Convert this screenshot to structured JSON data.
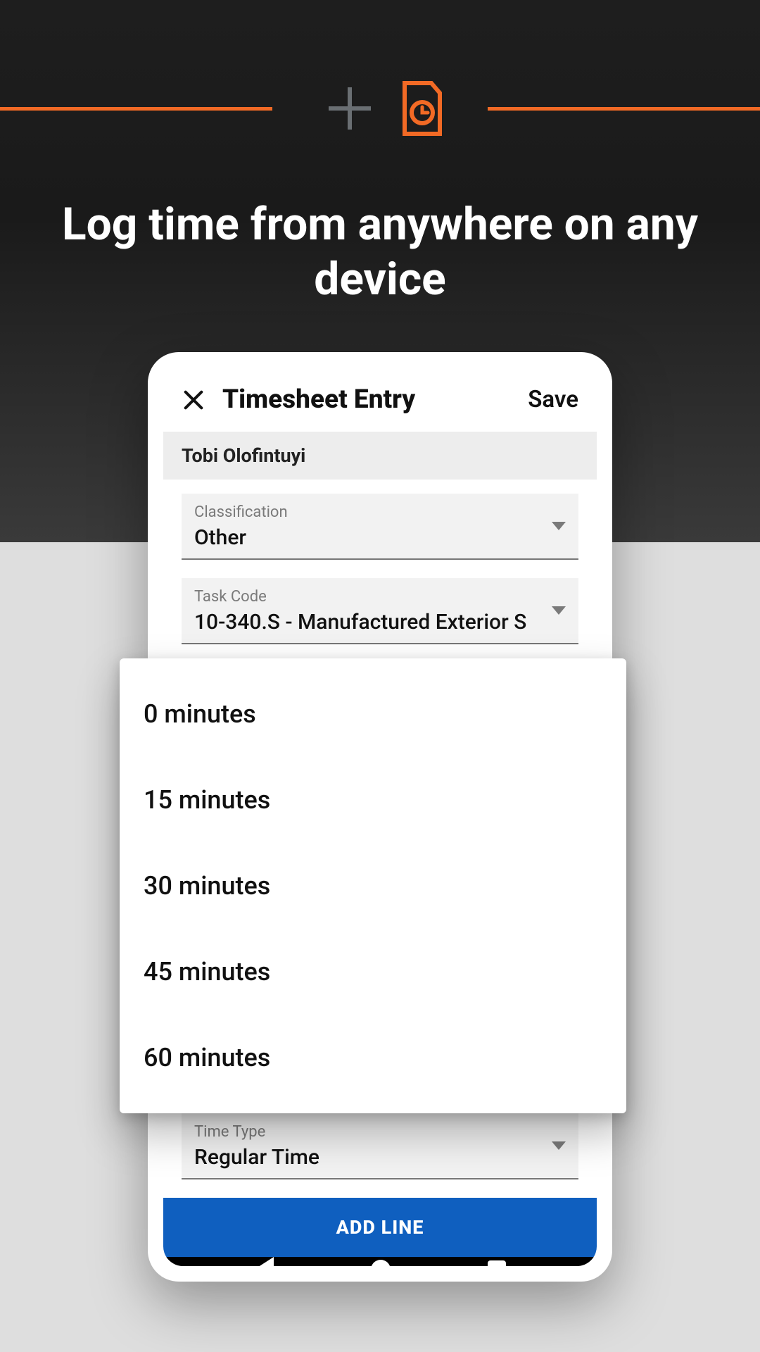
{
  "headline": "Log time from anywhere on any device",
  "appbar": {
    "title": "Timesheet Entry",
    "save_label": "Save"
  },
  "user_name": "Tobi Olofintuyi",
  "fields": {
    "classification": {
      "label": "Classification",
      "value": "Other"
    },
    "task_code": {
      "label": "Task Code",
      "value": "10-340.S - Manufactured Exterior S"
    },
    "time_type": {
      "label": "Time Type",
      "value": "Regular Time"
    }
  },
  "dropdown_options": [
    "0 minutes",
    "15 minutes",
    "30 minutes",
    "45 minutes",
    "60 minutes"
  ],
  "add_line_label": "ADD LINE",
  "colors": {
    "accent": "#f26a25",
    "primary_button": "#0f5fbf"
  }
}
